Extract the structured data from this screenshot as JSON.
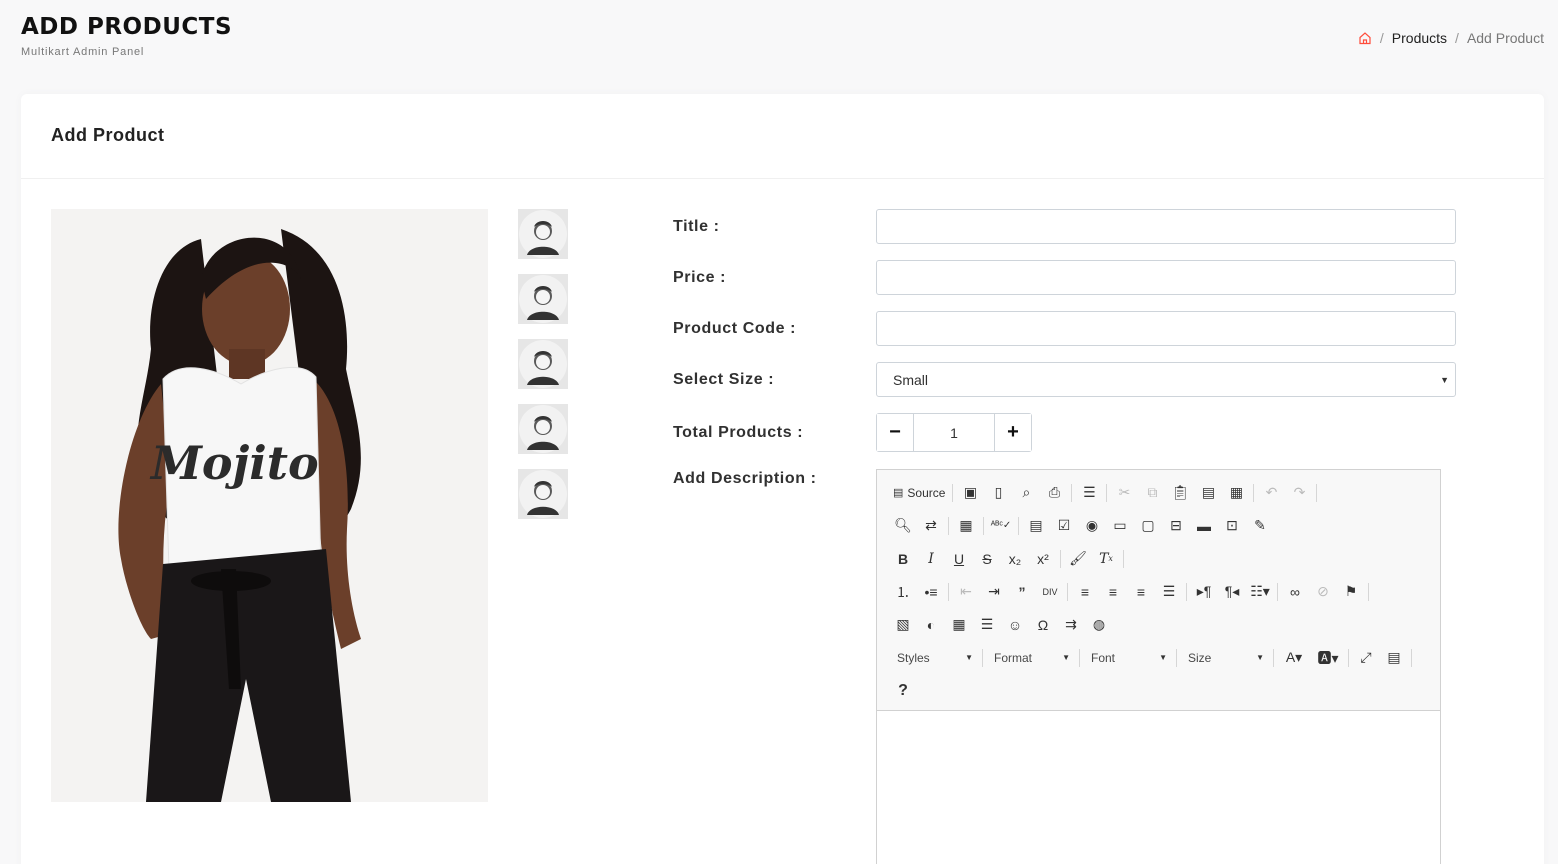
{
  "header": {
    "title": "ADD PRODUCTS",
    "subtitle": "Multikart Admin Panel"
  },
  "breadcrumb": {
    "separator": "/",
    "items": [
      "Products",
      "Add Product"
    ]
  },
  "card": {
    "title": "Add Product"
  },
  "form": {
    "title_label": "Title :",
    "title_value": "",
    "price_label": "Price :",
    "price_value": "",
    "code_label": "Product Code :",
    "code_value": "",
    "size_label": "Select Size :",
    "size_selected": "Small",
    "total_label": "Total Products :",
    "total_value": "1",
    "minus": "−",
    "plus": "+",
    "description_label": "Add Description :"
  },
  "editor": {
    "source_label": "Source",
    "combos": [
      "Styles",
      "Format",
      "Font",
      "Size"
    ],
    "help": "?"
  },
  "product_image": {
    "shirt_text": "Mojito"
  },
  "colors": {
    "accent": "#ff4c3b",
    "text": "#313131"
  }
}
